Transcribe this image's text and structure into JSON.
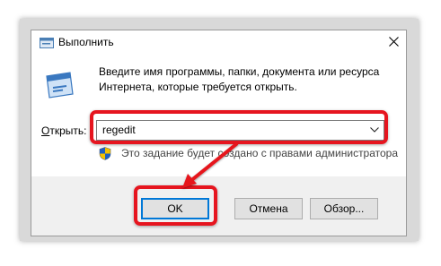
{
  "window": {
    "title": "Выполнить",
    "icon": "run-icon"
  },
  "content": {
    "description": "Введите имя программы, папки, документа или ресурса Интернета, которые требуется открыть.",
    "open_label_accel": "О",
    "open_label_rest": "ткрыть:",
    "input_value": "regedit",
    "admin_note": "Это задание будет создано с правами администратора"
  },
  "buttons": {
    "ok": "OK",
    "cancel": "Отмена",
    "browse": "Обзор..."
  },
  "colors": {
    "highlight": "#e6151f",
    "focus": "#0078d7"
  }
}
